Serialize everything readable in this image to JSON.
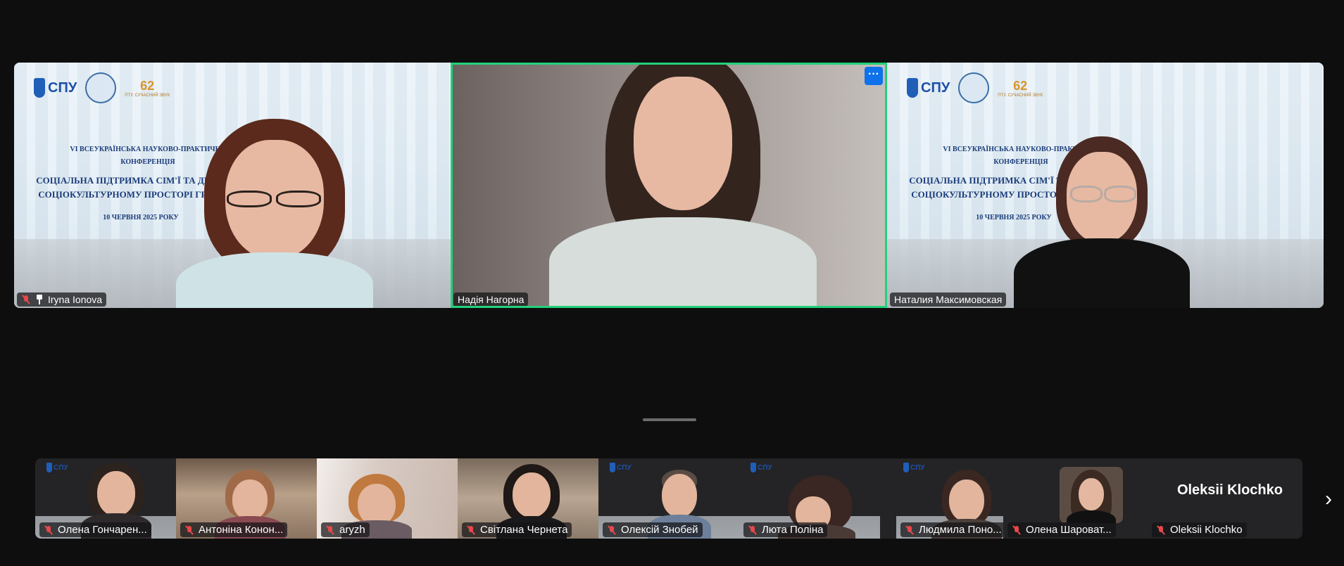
{
  "main_tiles": [
    {
      "name": "Iryna Ionova",
      "muted": true,
      "pinned": true
    },
    {
      "name": "Надія Нагорна",
      "active_speaker": true,
      "more_label": "···"
    },
    {
      "name": "Наталия Максимовская",
      "muted": false
    }
  ],
  "conference_slide": {
    "logo_text": "СПУ",
    "logo_number": "62",
    "logo_subtitle": "ПТУ. СУЧАСНИЙ ЗВУК",
    "line1": "VI ВСЕУКРАЇНСЬКА НАУКОВО-ПРАКТИЧНА",
    "line2": "КОНФЕРЕНЦІЯ",
    "line3": "СОЦІАЛЬНА ПІДТРИМКА СІМ'Ї ТА ДИТИ",
    "line4": "СОЦІОКУЛЬТУРНОМУ ПРОСТОРІ ГРОМ",
    "line5": "10 ЧЕРВНЯ 2025 РОКУ"
  },
  "thumbnails": [
    {
      "name": "Олена Гончарен..."
    },
    {
      "name": "Антоніна Конон..."
    },
    {
      "name": "aryzh"
    },
    {
      "name": "Світлана Чернета"
    },
    {
      "name": "Олексій Знобей"
    },
    {
      "name": "Люта Поліна"
    },
    {
      "name": "Людмила Поно..."
    },
    {
      "name": "Олена Шароват..."
    },
    {
      "name": "Oleksii Klochko",
      "title": "Oleksii Klochko"
    }
  ],
  "navigation": {
    "next_arrow": "›"
  },
  "colors": {
    "active_speaker_border": "#22d17a",
    "more_button": "#0e72ed",
    "mute_icon": "#e8484b",
    "background": "#0e0e0f"
  }
}
